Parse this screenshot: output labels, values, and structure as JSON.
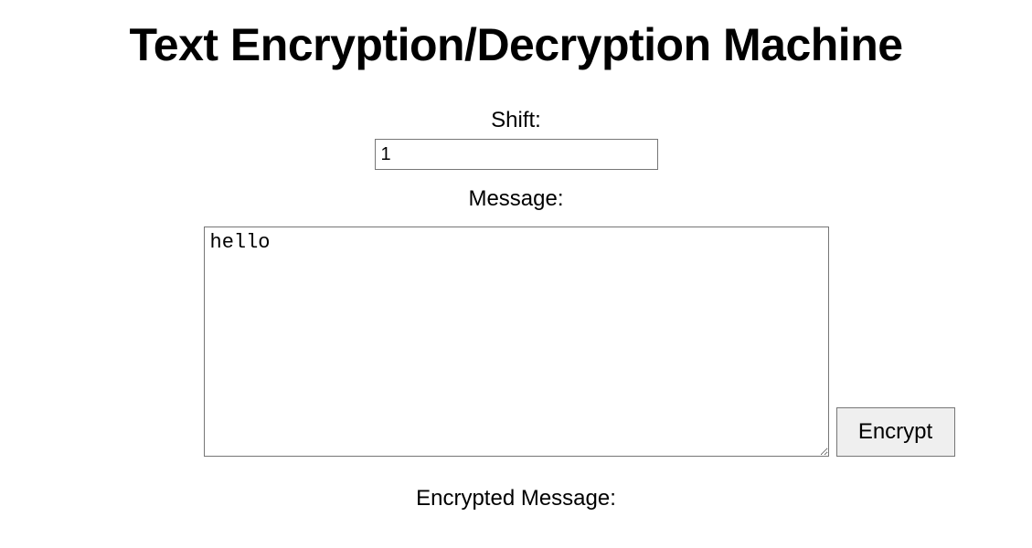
{
  "title": "Text Encryption/Decryption Machine",
  "shift": {
    "label": "Shift:",
    "value": "1"
  },
  "message": {
    "label": "Message:",
    "value": "hello"
  },
  "encryptButton": {
    "label": "Encrypt"
  },
  "encrypted": {
    "label": "Encrypted Message:"
  }
}
